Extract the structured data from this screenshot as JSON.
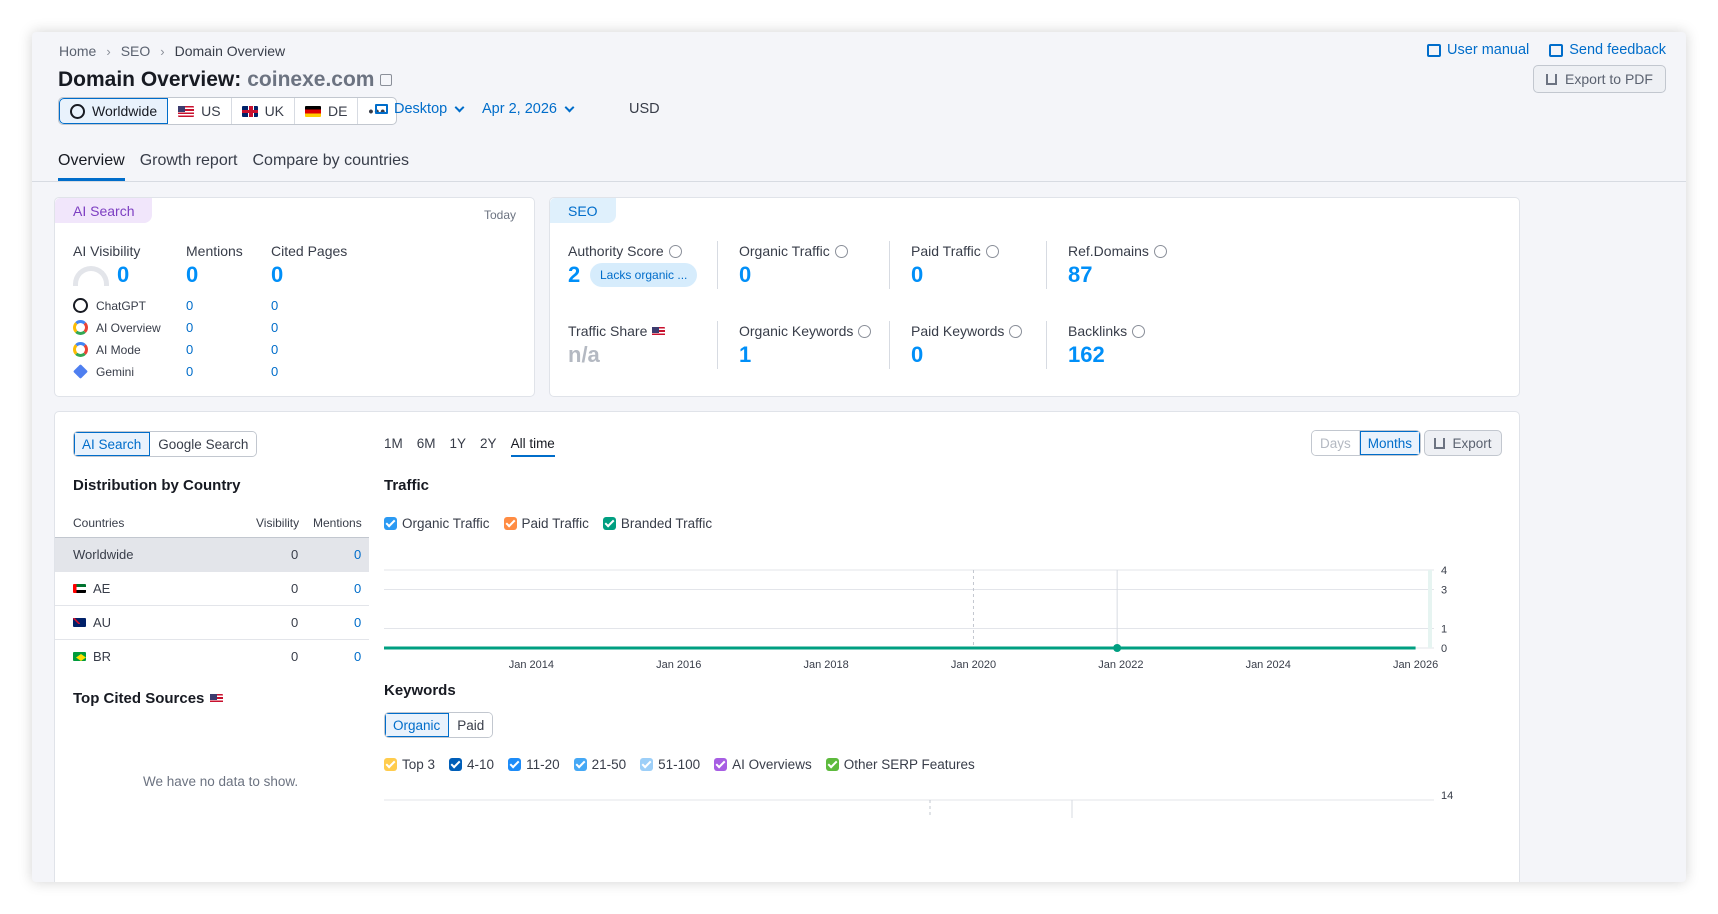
{
  "header": {
    "breadcrumb": [
      "Home",
      "SEO",
      "Domain Overview"
    ],
    "title_prefix": "Domain Overview:",
    "domain": "coinexe.com",
    "user_manual": "User manual",
    "send_feedback": "Send feedback",
    "export_pdf": "Export to PDF"
  },
  "databases": {
    "worldwide": "Worldwide",
    "us": "US",
    "uk": "UK",
    "de": "DE",
    "more": "•••"
  },
  "filters": {
    "device": "Desktop",
    "date": "Apr 2, 2026",
    "currency": "USD"
  },
  "tabs": [
    "Overview",
    "Growth report",
    "Compare by countries"
  ],
  "ai_search": {
    "tag": "AI Search",
    "updated": "Today",
    "visibility_label": "AI Visibility",
    "visibility_value": "0",
    "mentions_label": "Mentions",
    "mentions_value": "0",
    "cited_label": "Cited Pages",
    "cited_value": "0",
    "engines": [
      {
        "name": "ChatGPT",
        "mentions": "0",
        "cited": "0"
      },
      {
        "name": "AI Overview",
        "mentions": "0",
        "cited": "0"
      },
      {
        "name": "AI Mode",
        "mentions": "0",
        "cited": "0"
      },
      {
        "name": "Gemini",
        "mentions": "0",
        "cited": "0"
      }
    ]
  },
  "seo": {
    "tag": "SEO",
    "authority_score_label": "Authority Score",
    "authority_score_value": "2",
    "authority_pill": "Lacks organic ...",
    "organic_traffic_label": "Organic Traffic",
    "organic_traffic_value": "0",
    "paid_traffic_label": "Paid Traffic",
    "paid_traffic_value": "0",
    "ref_domains_label": "Ref.Domains",
    "ref_domains_value": "87",
    "traffic_share_label": "Traffic Share",
    "traffic_share_value": "n/a",
    "organic_keywords_label": "Organic Keywords",
    "organic_keywords_value": "1",
    "paid_keywords_label": "Paid Keywords",
    "paid_keywords_value": "0",
    "backlinks_label": "Backlinks",
    "backlinks_value": "162"
  },
  "distribution": {
    "toggle": [
      "AI Search",
      "Google Search"
    ],
    "title": "Distribution by Country",
    "col_countries": "Countries",
    "col_visibility": "Visibility",
    "col_mentions": "Mentions",
    "rows": [
      {
        "country": "Worldwide",
        "visibility": "0",
        "mentions": "0"
      },
      {
        "country": "AE",
        "visibility": "0",
        "mentions": "0"
      },
      {
        "country": "AU",
        "visibility": "0",
        "mentions": "0"
      },
      {
        "country": "BR",
        "visibility": "0",
        "mentions": "0"
      }
    ],
    "top_cited_title": "Top Cited Sources",
    "no_data": "We have no data to show."
  },
  "chart_controls": {
    "periods": [
      "1M",
      "6M",
      "1Y",
      "2Y",
      "All time"
    ],
    "granularity": [
      "Days",
      "Months"
    ],
    "export": "Export"
  },
  "traffic": {
    "title": "Traffic",
    "legend": [
      "Organic Traffic",
      "Paid Traffic",
      "Branded Traffic"
    ]
  },
  "keywords": {
    "title": "Keywords",
    "toggle": [
      "Organic",
      "Paid"
    ],
    "legend": [
      "Top 3",
      "4-10",
      "11-20",
      "21-50",
      "51-100",
      "AI Overviews",
      "Other SERP Features"
    ],
    "y_top_label": "14"
  },
  "colors": {
    "accent": "#006dca",
    "value_blue": "#008ff8",
    "organic": "#2b9af3",
    "paid": "#ff8c43",
    "branded": "#009f81",
    "top3": "#ffcc4d",
    "k4_10": "#005eb8",
    "k11_20": "#1d8cf8",
    "k21_50": "#45a8f5",
    "k51_100": "#9dcff8",
    "ai_overviews": "#a75ee3",
    "serp": "#5dba3d"
  },
  "chart_data": {
    "type": "line",
    "title": "Traffic",
    "xlabel": "",
    "ylabel": "",
    "x_ticks": [
      "Jan 2014",
      "Jan 2016",
      "Jan 2018",
      "Jan 2020",
      "Jan 2022",
      "Jan 2024",
      "Jan 2026"
    ],
    "y_ticks": [
      "4",
      "3",
      "1",
      "0"
    ],
    "ylim": [
      0,
      4
    ],
    "series": [
      {
        "name": "Branded Traffic",
        "x": [
          "Jan 2012",
          "Jan 2026"
        ],
        "values": [
          0,
          0
        ]
      }
    ],
    "grid": true,
    "legend_position": "top-left"
  }
}
